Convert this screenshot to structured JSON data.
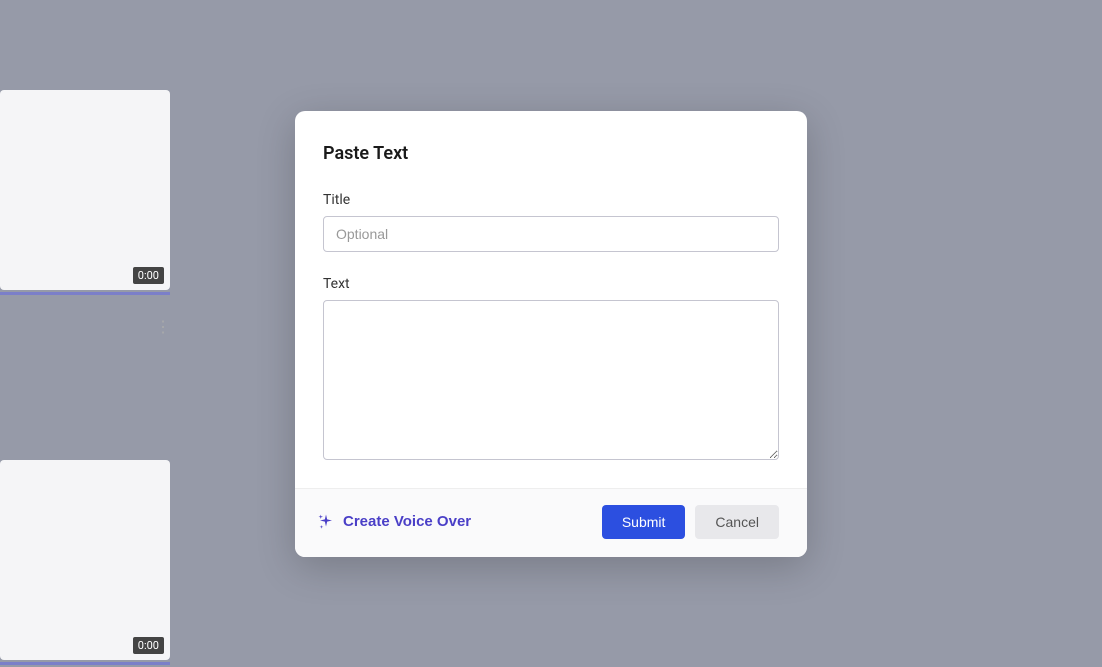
{
  "background": {
    "card1_timestamp": "0:00",
    "card2_timestamp": "0:00",
    "more_icon": "⋮"
  },
  "modal": {
    "title": "Paste Text",
    "title_field": {
      "label": "Title",
      "placeholder": "Optional",
      "value": ""
    },
    "text_field": {
      "label": "Text",
      "value": ""
    },
    "voice_over_label": "Create Voice Over",
    "submit_label": "Submit",
    "cancel_label": "Cancel"
  }
}
